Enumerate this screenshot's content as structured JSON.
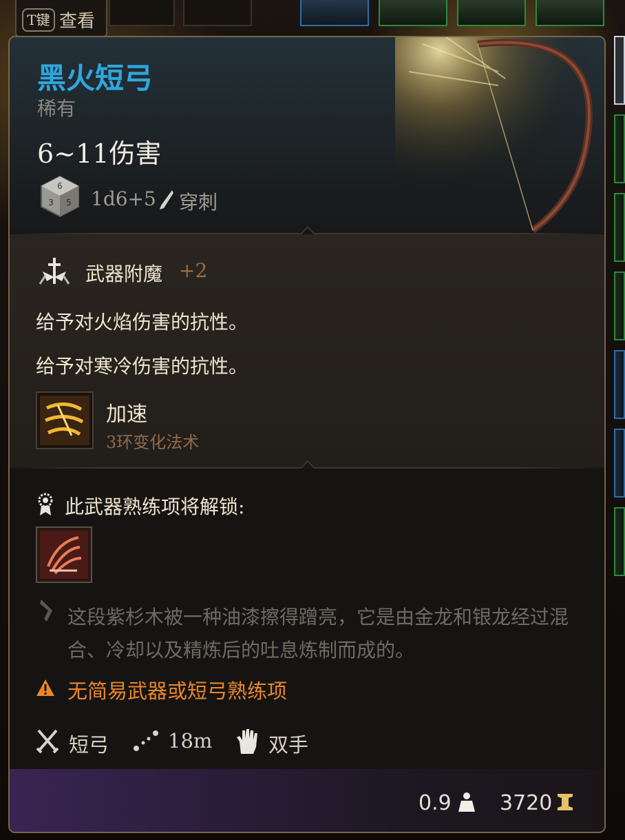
{
  "header_tab": {
    "key_label": "T键",
    "action_label": "查看"
  },
  "item": {
    "name": "黑火短弓",
    "rarity": "稀有",
    "damage": "6~11伤害",
    "dice": "1d6+5",
    "damage_type": "穿刺",
    "name_color": "#2fa6de"
  },
  "enchantment": {
    "label": "武器附魔",
    "value": "+2"
  },
  "resistances": [
    "给予对火焰伤害的抗性。",
    "给予对寒冷伤害的抗性。"
  ],
  "spell": {
    "name": "加速",
    "detail": "3环变化法术"
  },
  "proficiency": {
    "unlock_label": "此武器熟练项将解锁:"
  },
  "description": "这段紫杉木被一种油漆擦得蹭亮，它是由金龙和银龙经过混合、冷却以及精炼后的吐息炼制而成的。",
  "warning": {
    "text": "无简易武器或短弓熟练项",
    "color": "#e9872a"
  },
  "properties": {
    "weapon_type": "短弓",
    "range": "18m",
    "hands": "双手"
  },
  "footer": {
    "weight": "0.9",
    "price": "3720"
  },
  "icons": [
    "dice-icon",
    "pierce-icon",
    "enchant-icon",
    "haste-spell-icon",
    "proficiency-icon",
    "proficiency-skill-icon",
    "quill-icon",
    "warning-icon",
    "crossed-swords-icon",
    "range-icon",
    "hand-icon",
    "weight-icon",
    "gold-coin-icon"
  ]
}
